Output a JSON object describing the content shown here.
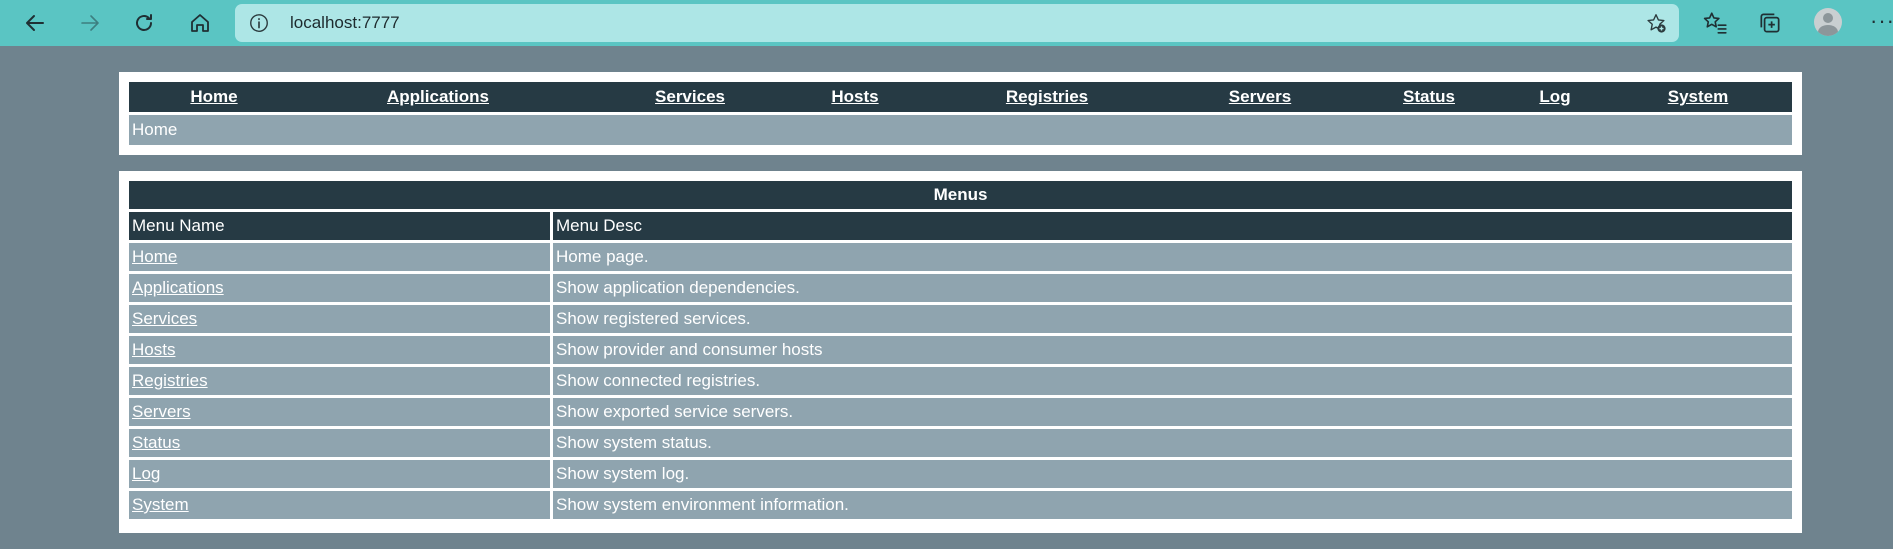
{
  "browser": {
    "url": "localhost:7777",
    "icons": {
      "back": "arrow-left-icon",
      "forward": "arrow-right-icon",
      "refresh": "refresh-icon",
      "home": "home-icon",
      "info": "info-icon",
      "add_favorite": "star-plus-icon",
      "favorites": "favorites-list-icon",
      "collections": "collections-icon",
      "profile": "avatar-icon",
      "more": "more-icon"
    },
    "colors": {
      "chrome": "#5ac5c3",
      "address_bar": "#ade6e6"
    }
  },
  "nav": {
    "items": [
      {
        "label": "Home"
      },
      {
        "label": "Applications"
      },
      {
        "label": "Services"
      },
      {
        "label": "Hosts"
      },
      {
        "label": "Registries"
      },
      {
        "label": "Servers"
      },
      {
        "label": "Status"
      },
      {
        "label": "Log"
      },
      {
        "label": "System"
      }
    ]
  },
  "breadcrumb": {
    "text": "Home"
  },
  "menus": {
    "title": "Menus",
    "columns": [
      "Menu Name",
      "Menu Desc"
    ],
    "rows": [
      {
        "name": "Home",
        "desc": "Home page."
      },
      {
        "name": "Applications",
        "desc": "Show application dependencies."
      },
      {
        "name": "Services",
        "desc": "Show registered services."
      },
      {
        "name": "Hosts",
        "desc": "Show provider and consumer hosts"
      },
      {
        "name": "Registries",
        "desc": "Show connected registries."
      },
      {
        "name": "Servers",
        "desc": "Show exported service servers."
      },
      {
        "name": "Status",
        "desc": "Show system status."
      },
      {
        "name": "Log",
        "desc": "Show system log."
      },
      {
        "name": "System",
        "desc": "Show system environment information."
      }
    ]
  },
  "colors": {
    "page_bg": "#6f838e",
    "header_bg": "#263a44",
    "row_bg": "#8fa4af",
    "text": "#ffffff"
  }
}
